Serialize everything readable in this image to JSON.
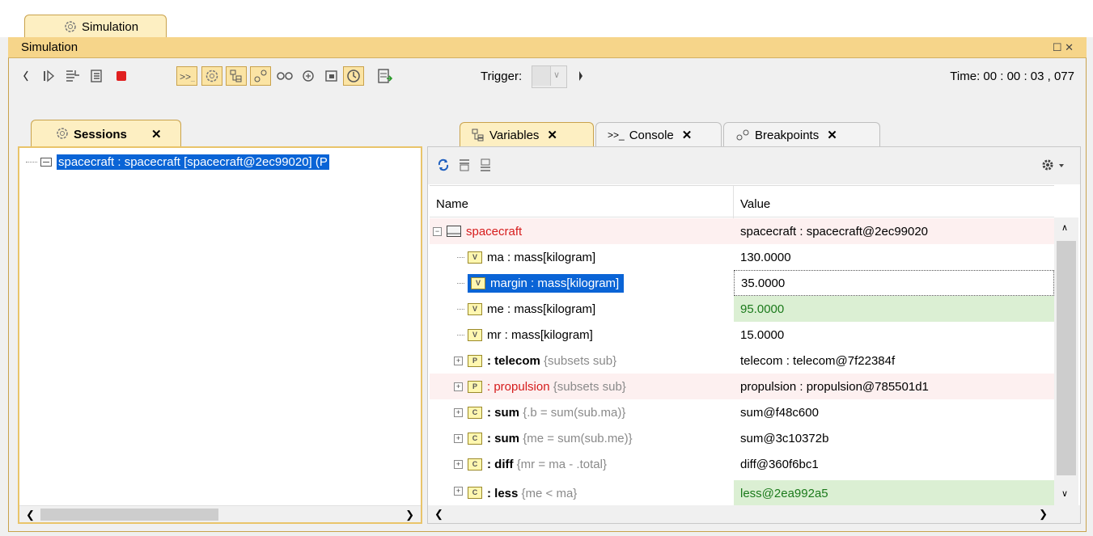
{
  "window_tab": {
    "label": "Simulation",
    "icon": "simulation-gear-icon"
  },
  "titlebar": {
    "title": "Simulation",
    "controls": "☐ ✕"
  },
  "toolbar": {
    "trigger_label": "Trigger:",
    "time_label": "Time: 00 : 00 : 03 , 077"
  },
  "sessions": {
    "tab_label": "Sessions",
    "close": "✕",
    "item": "spacecraft : spacecraft [spacecraft@2ec99020] (P"
  },
  "tabs": [
    {
      "label": "Variables",
      "icon": "variables-icon"
    },
    {
      "label": "Console",
      "icon": "console-icon"
    },
    {
      "label": "Breakpoints",
      "icon": "breakpoints-icon"
    }
  ],
  "close_glyph": "✕",
  "grid": {
    "headers": [
      "Name",
      "Value"
    ],
    "rows": [
      {
        "name": "spacecraft",
        "extra": "",
        "value": "spacecraft : spacecraft@2ec99020"
      },
      {
        "name": "ma : mass[kilogram]",
        "extra": "",
        "value": "130.0000"
      },
      {
        "name": "margin : mass[kilogram]",
        "extra": "",
        "value": "35.0000"
      },
      {
        "name": "me : mass[kilogram]",
        "extra": "",
        "value": "95.0000"
      },
      {
        "name": "mr : mass[kilogram]",
        "extra": "",
        "value": "15.0000"
      },
      {
        "name": ": telecom",
        "extra": "{subsets sub}",
        "value": "telecom : telecom@7f22384f"
      },
      {
        "name": ": propulsion",
        "extra": "{subsets sub}",
        "value": "propulsion : propulsion@785501d1"
      },
      {
        "name": ": sum",
        "extra": "{.b = sum(sub.ma)}",
        "value": "sum@f48c600"
      },
      {
        "name": ": sum",
        "extra": "{me = sum(sub.me)}",
        "value": "sum@3c10372b"
      },
      {
        "name": ": diff",
        "extra": "{mr = ma - .total}",
        "value": "diff@360f6bc1"
      },
      {
        "name": ": less",
        "extra": "{me < ma}",
        "value": "less@2ea992a5"
      }
    ]
  },
  "colors": {
    "tab_active": "#fdefc2",
    "titlebar": "#f6d58a",
    "selection": "#0a64d6",
    "error_text": "#d61c1c",
    "ok_bg": "#dbefd3"
  }
}
